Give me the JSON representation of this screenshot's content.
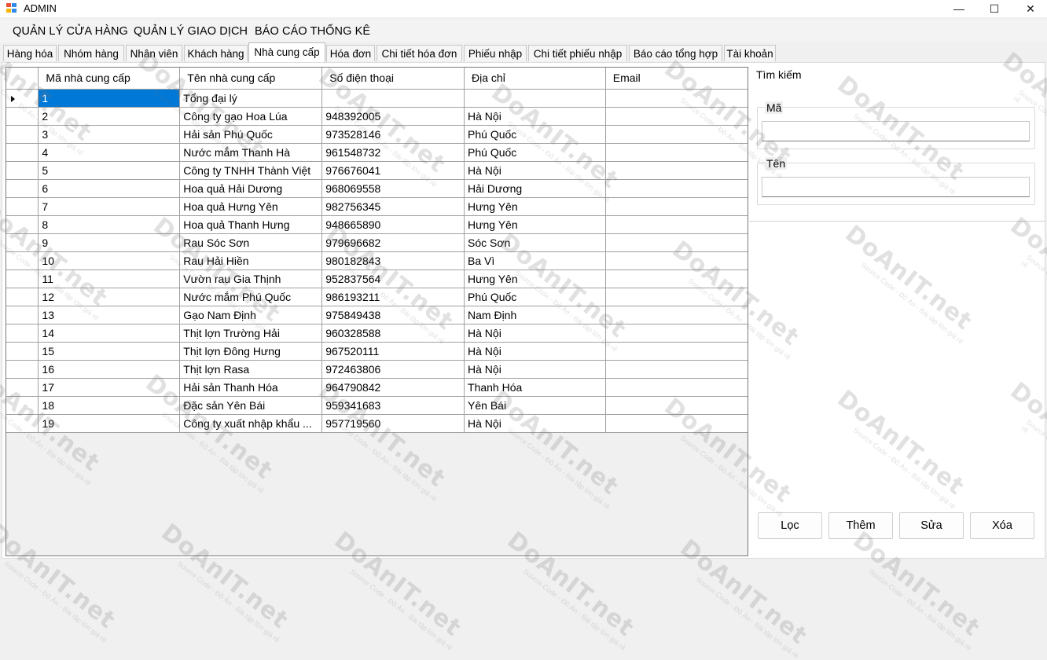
{
  "window": {
    "title": "ADMIN",
    "minimize_glyph": "—",
    "maximize_glyph": "☐",
    "close_glyph": "✕"
  },
  "menu": [
    "QUẢN LÝ CỬA HÀNG",
    "QUẢN LÝ GIAO DỊCH",
    "BÁO CÁO THỐNG KÊ"
  ],
  "tabs": [
    "Hàng hóa",
    "Nhóm hàng",
    "Nhân viên",
    "Khách hàng",
    "Nhà cung cấp",
    "Hóa đơn",
    "Chi tiết hóa đơn",
    "Phiếu nhập",
    "Chi tiết phiếu nhập",
    "Báo cáo tổng hợp",
    "Tài khoản"
  ],
  "active_tab": "Nhà cung cấp",
  "grid": {
    "columns": [
      "Mã nhà cung cấp",
      "Tên nhà cung cấp",
      "Số điện thoại",
      "Địa chỉ",
      "Email"
    ],
    "rows": [
      [
        "1",
        "Tổng đại lý",
        "",
        "",
        ""
      ],
      [
        "2",
        "Công ty gạo Hoa Lúa",
        "948392005",
        "Hà Nội",
        ""
      ],
      [
        "3",
        "Hải sản Phú Quốc",
        "973528146",
        "Phú Quốc",
        ""
      ],
      [
        "4",
        "Nước mắm Thanh Hà",
        "961548732",
        "Phú Quốc",
        ""
      ],
      [
        "5",
        "Công ty TNHH Thành Việt",
        "976676041",
        "Hà Nội",
        ""
      ],
      [
        "6",
        "Hoa quả Hải Dương",
        "968069558",
        "Hải Dương",
        ""
      ],
      [
        "7",
        "Hoa quả Hưng Yên",
        "982756345",
        "Hưng Yên",
        ""
      ],
      [
        "8",
        "Hoa quả Thanh Hưng",
        "948665890",
        "Hưng Yên",
        ""
      ],
      [
        "9",
        "Rau Sóc Sơn",
        "979696682",
        "Sóc Sơn",
        ""
      ],
      [
        "10",
        "Rau Hải Hiền",
        "980182843",
        "Ba Vì",
        ""
      ],
      [
        "11",
        "Vườn rau Gia Thịnh",
        "952837564",
        "Hưng Yên",
        ""
      ],
      [
        "12",
        "Nước mắm Phú Quốc",
        "986193211",
        "Phú Quốc",
        ""
      ],
      [
        "13",
        "Gạo Nam Định",
        "975849438",
        "Nam Định",
        ""
      ],
      [
        "14",
        "Thịt lợn Trường Hải",
        "960328588",
        "Hà Nội",
        ""
      ],
      [
        "15",
        "Thịt lợn Đông Hưng",
        "967520111",
        "Hà Nội",
        ""
      ],
      [
        "16",
        "Thịt lợn Rasa",
        "972463806",
        "Hà Nội",
        ""
      ],
      [
        "17",
        "Hải sản Thanh Hóa",
        "964790842",
        "Thanh Hóa",
        ""
      ],
      [
        "18",
        "Đặc sản Yên Bái",
        "959341683",
        "Yên Bái",
        ""
      ],
      [
        "19",
        "Công ty xuất nhập khẩu ...",
        "957719560",
        "Hà Nội",
        ""
      ]
    ],
    "selected_row": 0
  },
  "search": {
    "group_title": "Tìm kiếm",
    "code_label": "Mã",
    "code_value": "",
    "name_label": "Tên",
    "name_value": ""
  },
  "buttons": {
    "filter": "Lọc",
    "add": "Thêm",
    "edit": "Sửa",
    "delete": "Xóa"
  },
  "watermark": {
    "logo": "DoAnIT.net",
    "tagline": "Source Code - Đồ Án - Bài tập lớn giá rẻ"
  },
  "colors": {
    "selection": "#0078d7",
    "window_bg": "#f0f0f0"
  }
}
